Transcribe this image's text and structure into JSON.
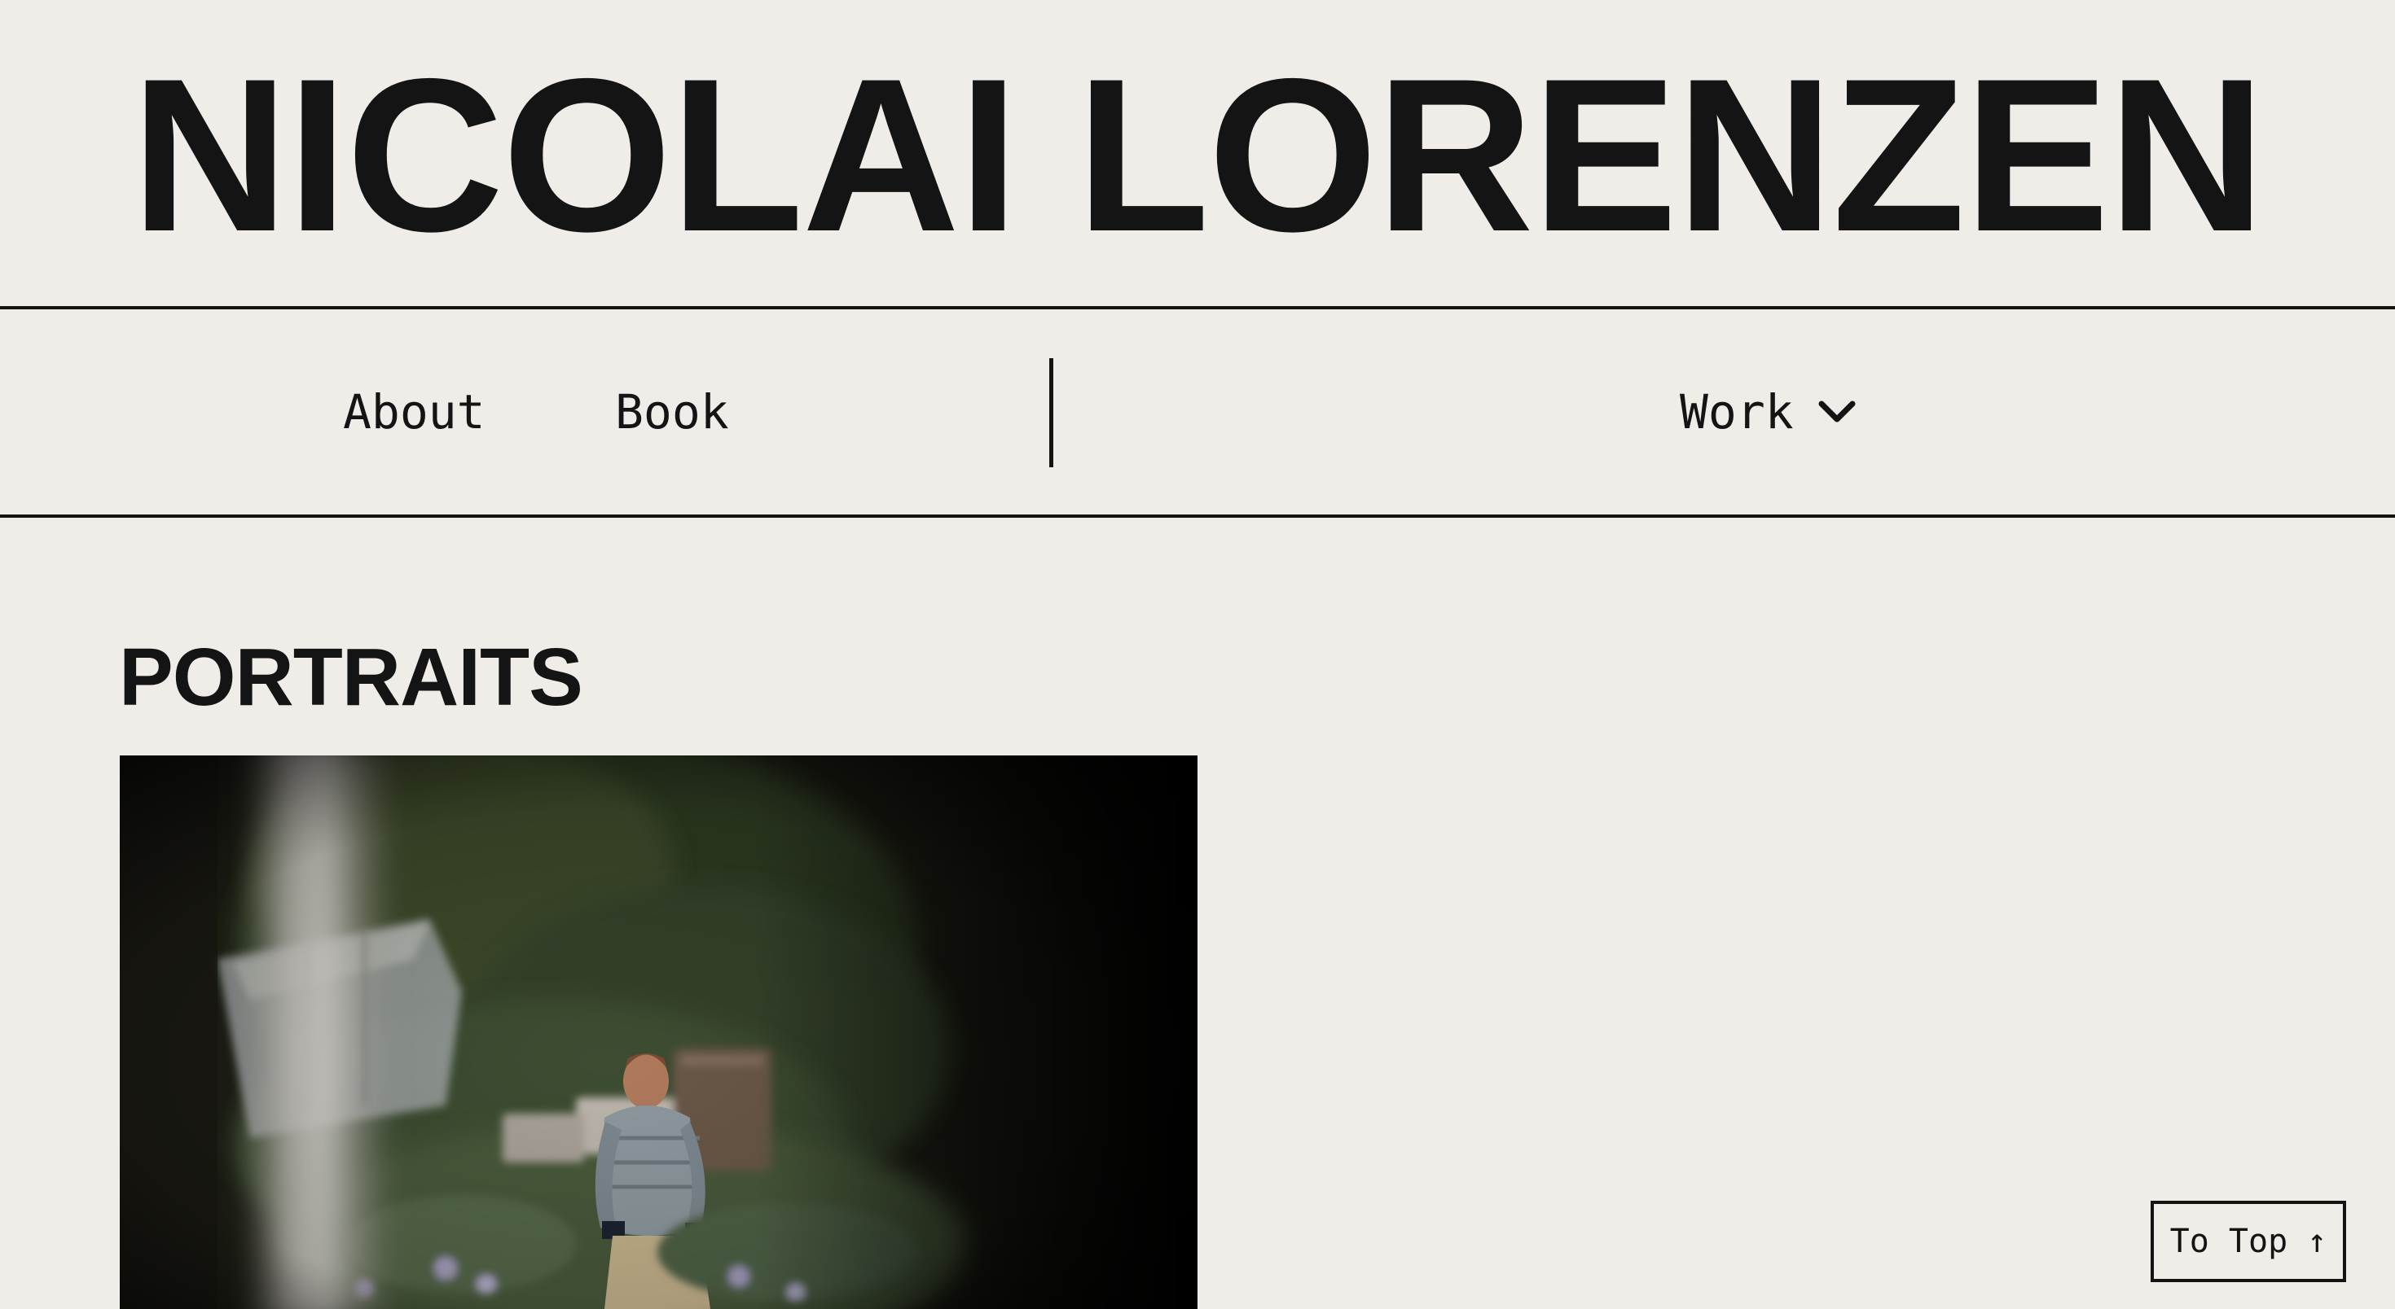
{
  "header": {
    "title": "NICOLAI LORENZEN"
  },
  "nav": {
    "about": "About",
    "book": "Book",
    "work": "Work",
    "work_icon": "chevron-down-icon"
  },
  "main": {
    "section_title": "PORTRAITS"
  },
  "footer": {
    "to_top": "To Top ↑"
  },
  "colors": {
    "background": "#f0ede9",
    "text": "#141414"
  }
}
